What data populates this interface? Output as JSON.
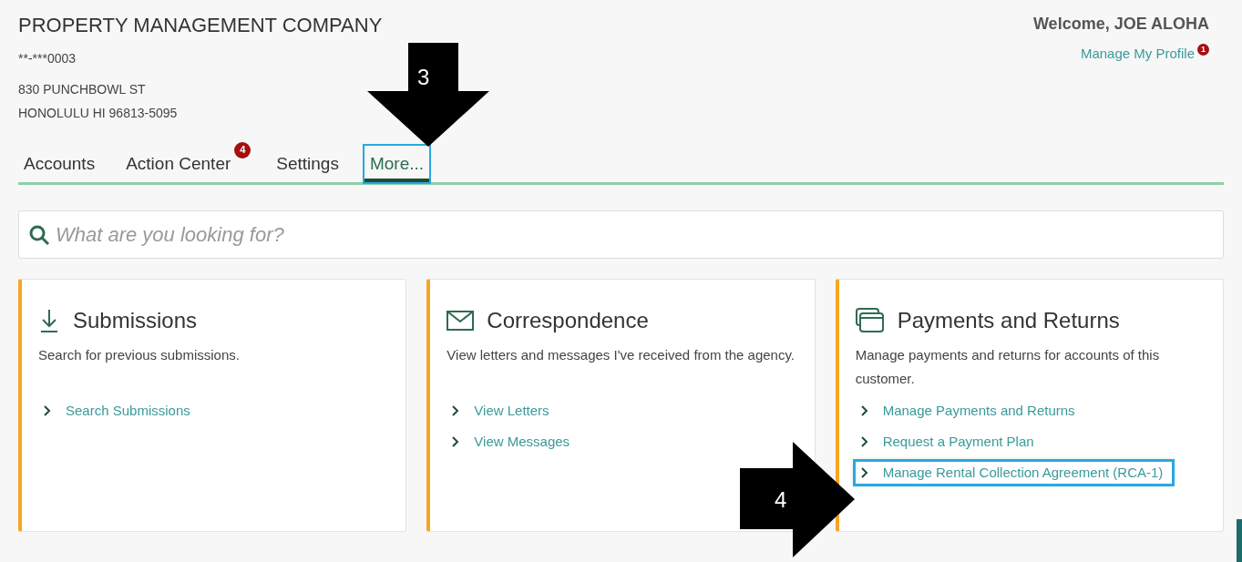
{
  "header": {
    "company": "PROPERTY MANAGEMENT COMPANY",
    "account_id": "**-***0003",
    "address_lines": [
      "830 PUNCHBOWL ST",
      "HONOLULU HI 96813-5095"
    ],
    "welcome": "Welcome, JOE ALOHA",
    "profile_link": "Manage My Profile",
    "profile_badge": "1"
  },
  "tabs": [
    {
      "label": "Accounts",
      "selected": false,
      "highlighted": false
    },
    {
      "label": "Action Center",
      "selected": false,
      "highlighted": false,
      "badge": "4"
    },
    {
      "label": "Settings",
      "selected": false,
      "highlighted": false
    },
    {
      "label": "More...",
      "selected": true,
      "highlighted": true
    }
  ],
  "search": {
    "placeholder": "What are you looking for?"
  },
  "cards": [
    {
      "kind": "download",
      "title": "Submissions",
      "description": "Search for previous submissions.",
      "links": [
        {
          "label": "Search Submissions",
          "highlighted": false
        }
      ]
    },
    {
      "kind": "mail",
      "title": "Correspondence",
      "description": "View letters and messages I've received from the agency.",
      "links": [
        {
          "label": "View Letters",
          "highlighted": false
        },
        {
          "label": "View Messages",
          "highlighted": false
        }
      ]
    },
    {
      "kind": "payments",
      "title": "Payments and Returns",
      "description": "Manage payments and returns for accounts of this customer.",
      "links": [
        {
          "label": "Manage Payments and Returns",
          "highlighted": false
        },
        {
          "label": "Request a Payment Plan",
          "highlighted": false
        },
        {
          "label": "Manage Rental Collection Agreement (RCA-1)",
          "highlighted": true
        }
      ]
    }
  ],
  "callouts": [
    {
      "kind": "down",
      "number": "3"
    },
    {
      "kind": "right",
      "number": "4"
    }
  ]
}
